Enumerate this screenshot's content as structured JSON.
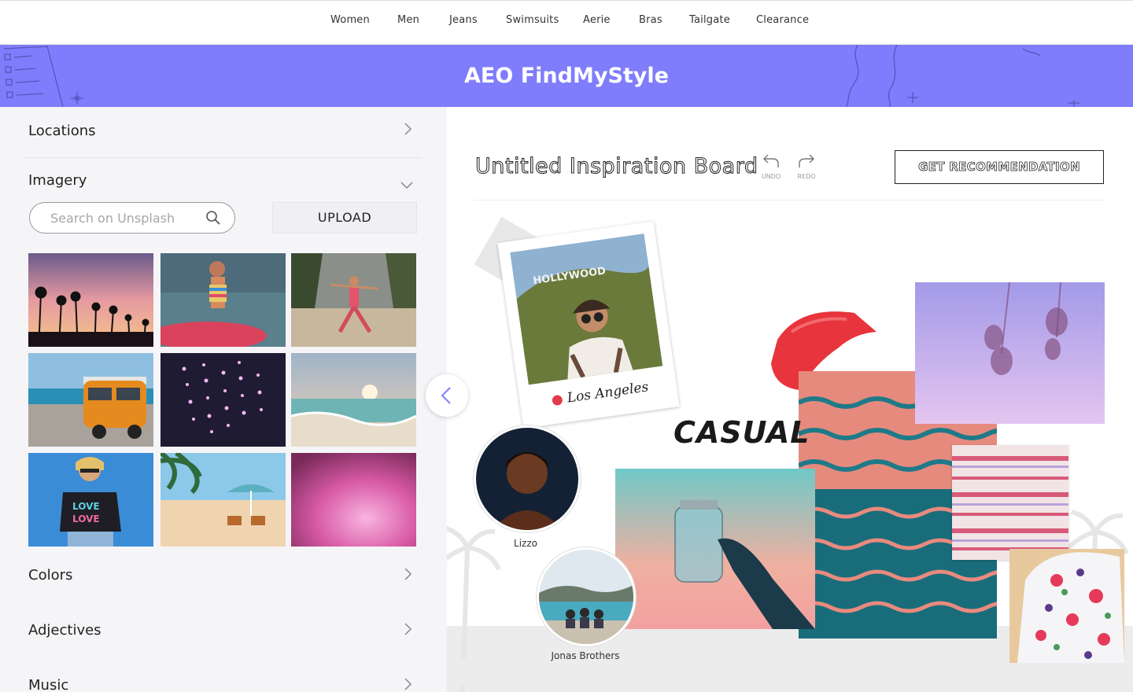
{
  "nav": {
    "items": [
      "Women",
      "Men",
      "Jeans",
      "Swimsuits",
      "Aerie",
      "Bras",
      "Tailgate",
      "Clearance"
    ]
  },
  "banner": {
    "title": "AEO FindMyStyle",
    "color": "#7f7dfb"
  },
  "sidebar": {
    "locations_label": "Locations",
    "imagery_label": "Imagery",
    "search_placeholder": "Search on Unsplash",
    "upload_label": "UPLOAD",
    "thumbnails": [
      "palm-sunset",
      "woman-paddleboard",
      "beach-yoga",
      "orange-van",
      "fairy-lights",
      "ocean-sunset",
      "woman-love-tee",
      "beach-umbrella",
      "pink-clouds"
    ],
    "colors_label": "Colors",
    "adjectives_label": "Adjectives",
    "music_label": "Music"
  },
  "board": {
    "title": "Untitled Inspiration Board",
    "undo_label": "UNDO",
    "redo_label": "REDO",
    "get_recommendation_label": "GET RECOMMENDATION",
    "polaroid_caption": "Los Angeles",
    "polaroid_sign": "HOLLYWOOD",
    "sticker_text": "CASUAL",
    "artist_1": "Lizzo",
    "artist_2": "Jonas Brothers"
  },
  "colors": {
    "accent": "#7f7dfb",
    "lipstick": "#e8343c"
  }
}
